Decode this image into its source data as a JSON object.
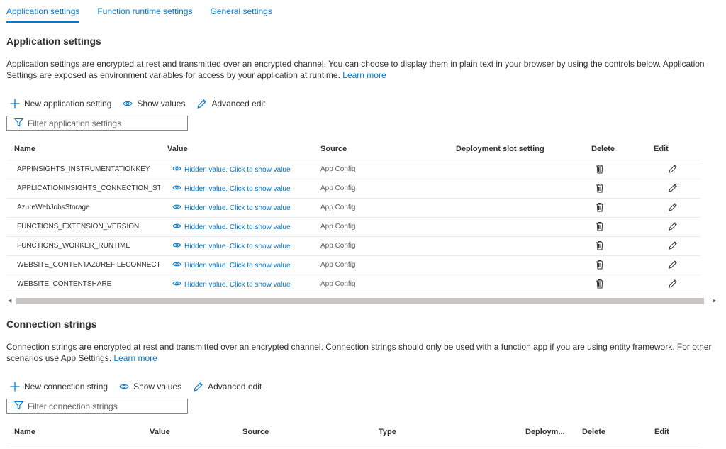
{
  "tabs": [
    {
      "label": "Application settings",
      "active": true
    },
    {
      "label": "Function runtime settings",
      "active": false
    },
    {
      "label": "General settings",
      "active": false
    }
  ],
  "app_settings": {
    "title": "Application settings",
    "description": "Application settings are encrypted at rest and transmitted over an encrypted channel. You can choose to display them in plain text in your browser by using the controls below. Application Settings are exposed as environment variables for access by your application at runtime.",
    "learn_more": "Learn more",
    "toolbar": {
      "new_label": "New application setting",
      "show_label": "Show values",
      "advanced_label": "Advanced edit"
    },
    "filter_placeholder": "Filter application settings",
    "columns": {
      "name": "Name",
      "value": "Value",
      "source": "Source",
      "slot": "Deployment slot setting",
      "delete": "Delete",
      "edit": "Edit"
    },
    "hidden_value_text": "Hidden value. Click to show value",
    "rows": [
      {
        "name": "APPINSIGHTS_INSTRUMENTATIONKEY",
        "source": "App Config"
      },
      {
        "name": "APPLICATIONINSIGHTS_CONNECTION_STRIN",
        "source": "App Config"
      },
      {
        "name": "AzureWebJobsStorage",
        "source": "App Config"
      },
      {
        "name": "FUNCTIONS_EXTENSION_VERSION",
        "source": "App Config"
      },
      {
        "name": "FUNCTIONS_WORKER_RUNTIME",
        "source": "App Config"
      },
      {
        "name": "WEBSITE_CONTENTAZUREFILECONNECTION:",
        "source": "App Config"
      },
      {
        "name": "WEBSITE_CONTENTSHARE",
        "source": "App Config"
      }
    ]
  },
  "conn_strings": {
    "title": "Connection strings",
    "description": "Connection strings are encrypted at rest and transmitted over an encrypted channel. Connection strings should only be used with a function app if you are using entity framework. For other scenarios use App Settings.",
    "learn_more": "Learn more",
    "toolbar": {
      "new_label": "New connection string",
      "show_label": "Show values",
      "advanced_label": "Advanced edit"
    },
    "filter_placeholder": "Filter connection strings",
    "columns": {
      "name": "Name",
      "value": "Value",
      "source": "Source",
      "type": "Type",
      "slot": "Deploym...",
      "delete": "Delete",
      "edit": "Edit"
    }
  },
  "colors": {
    "accent": "#0078d4",
    "text": "#323130",
    "border": "#8a8886"
  },
  "icons": {
    "add": "plus-icon",
    "show": "eye-icon",
    "advanced": "pencil-icon",
    "filter": "filter-icon",
    "delete": "trash-icon",
    "edit": "pencil-icon"
  }
}
